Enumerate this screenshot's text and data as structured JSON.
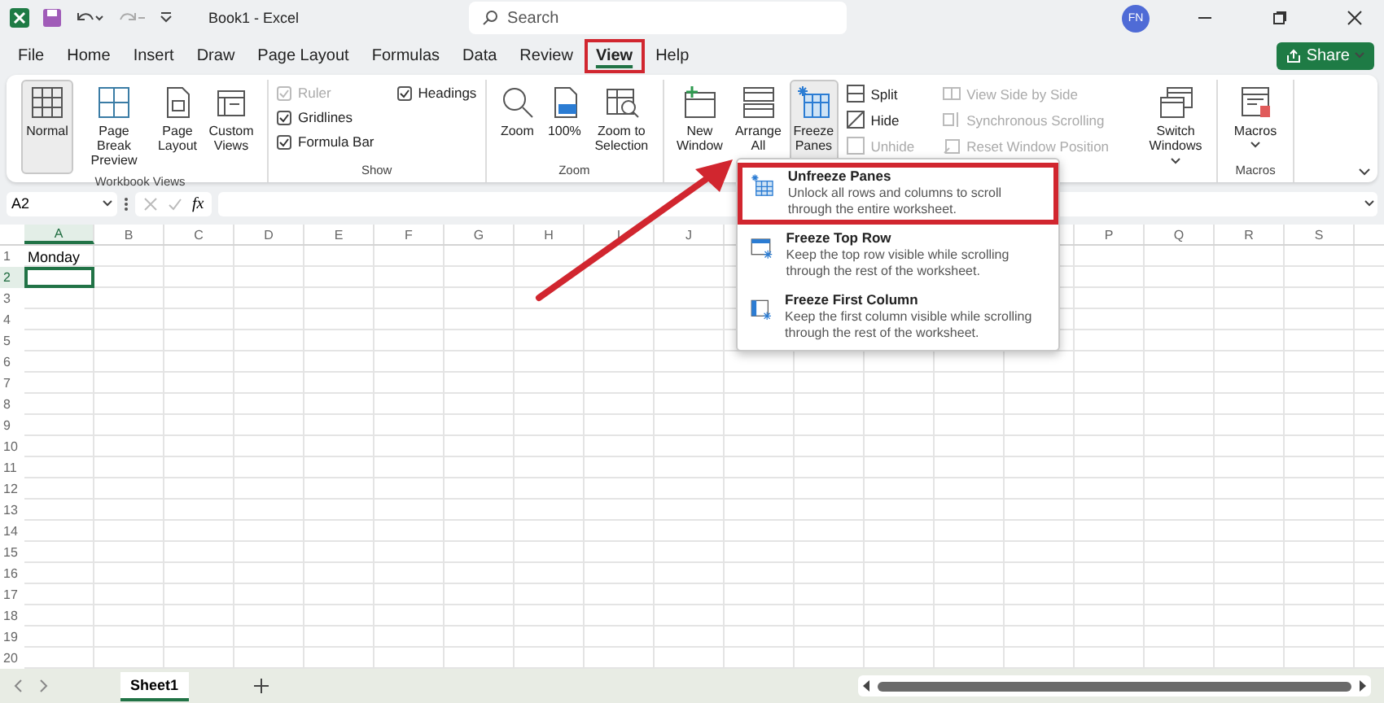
{
  "title_bar": {
    "title": "Book1  -  Excel",
    "search": {
      "placeholder": "Search"
    },
    "avatar": "FN"
  },
  "tabs": [
    {
      "label": "File",
      "selected": false,
      "highlighted": false
    },
    {
      "label": "Home",
      "selected": false,
      "highlighted": false
    },
    {
      "label": "Insert",
      "selected": false,
      "highlighted": false
    },
    {
      "label": "Draw",
      "selected": false,
      "highlighted": false
    },
    {
      "label": "Page Layout",
      "selected": false,
      "highlighted": false
    },
    {
      "label": "Formulas",
      "selected": false,
      "highlighted": false
    },
    {
      "label": "Data",
      "selected": false,
      "highlighted": false
    },
    {
      "label": "Review",
      "selected": false,
      "highlighted": false
    },
    {
      "label": "View",
      "selected": true,
      "highlighted": true
    },
    {
      "label": "Help",
      "selected": false,
      "highlighted": false
    }
  ],
  "share": "Share",
  "ribbon": {
    "workbook_views": {
      "label": "Workbook Views",
      "items": [
        {
          "label": "Normal",
          "selected": true
        },
        {
          "label": "Page Break Preview",
          "selected": false
        },
        {
          "label": "Page Layout",
          "selected": false
        },
        {
          "label": "Custom Views",
          "selected": false
        }
      ]
    },
    "show": {
      "label": "Show",
      "items": [
        {
          "label": "Ruler",
          "checked": true,
          "disabled": true
        },
        {
          "label": "Gridlines",
          "checked": true,
          "disabled": false
        },
        {
          "label": "Formula Bar",
          "checked": true,
          "disabled": false
        },
        {
          "label": "Headings",
          "checked": true,
          "disabled": false
        }
      ]
    },
    "zoom": {
      "label": "Zoom",
      "items": [
        {
          "label": "Zoom"
        },
        {
          "label": "100%"
        },
        {
          "label": "Zoom to Selection"
        }
      ]
    },
    "window": {
      "large": [
        {
          "label": "New Window",
          "selected": false
        },
        {
          "label": "Arrange All",
          "selected": false
        },
        {
          "label": "Freeze Panes",
          "selected": true
        }
      ],
      "small": [
        {
          "label": "Split",
          "disabled": false
        },
        {
          "label": "Hide",
          "disabled": false
        },
        {
          "label": "Unhide",
          "disabled": true
        },
        {
          "label": "View Side by Side",
          "disabled": true
        },
        {
          "label": "Synchronous Scrolling",
          "disabled": true
        },
        {
          "label": "Reset Window Position",
          "disabled": true
        }
      ],
      "switch": {
        "label": "Switch Windows"
      }
    },
    "macros": {
      "label": "Macros",
      "button": "Macros"
    }
  },
  "formula_bar": {
    "name_box": "A2",
    "fx": "fx"
  },
  "columns_left": [
    {
      "label": "A",
      "selected": true
    },
    {
      "label": "B",
      "selected": false
    },
    {
      "label": "C",
      "selected": false
    },
    {
      "label": "D",
      "selected": false
    },
    {
      "label": "E",
      "selected": false
    },
    {
      "label": "F",
      "selected": false
    },
    {
      "label": "G",
      "selected": false
    },
    {
      "label": "H",
      "selected": false
    },
    {
      "label": "I",
      "selected": false
    },
    {
      "label": "J",
      "selected": false
    }
  ],
  "columns_right": [
    {
      "label": "P",
      "selected": false
    },
    {
      "label": "Q",
      "selected": false
    },
    {
      "label": "R",
      "selected": false
    },
    {
      "label": "S",
      "selected": false
    }
  ],
  "rows": [
    {
      "header": "1",
      "selected": false,
      "cells": [
        "Monday"
      ]
    },
    {
      "header": "2",
      "selected": true
    },
    {
      "header": "3",
      "selected": false
    },
    {
      "header": "4",
      "selected": false
    },
    {
      "header": "5",
      "selected": false
    },
    {
      "header": "6",
      "selected": false
    },
    {
      "header": "7",
      "selected": false
    },
    {
      "header": "8",
      "selected": false
    },
    {
      "header": "9",
      "selected": false
    },
    {
      "header": "10",
      "selected": false
    },
    {
      "header": "11",
      "selected": false
    },
    {
      "header": "12",
      "selected": false
    },
    {
      "header": "13",
      "selected": false
    },
    {
      "header": "14",
      "selected": false
    },
    {
      "header": "15",
      "selected": false
    },
    {
      "header": "16",
      "selected": false
    },
    {
      "header": "17",
      "selected": false
    },
    {
      "header": "18",
      "selected": false
    },
    {
      "header": "19",
      "selected": false
    },
    {
      "header": "20",
      "selected": false
    }
  ],
  "freeze_menu": [
    {
      "kind": "unfreeze",
      "title": "Unfreeze Panes",
      "description": "Unlock all rows and columns to scroll through the entire worksheet.",
      "highlighted": true
    },
    {
      "kind": "top_row",
      "title": "Freeze Top Row",
      "description": "Keep the top row visible while scrolling through the rest of the worksheet.",
      "highlighted": false
    },
    {
      "kind": "first_column",
      "title": "Freeze First Column",
      "description": "Keep the first column visible while scrolling through the rest of the worksheet.",
      "highlighted": false
    }
  ],
  "sheets": [
    {
      "label": "Sheet1",
      "selected": true
    }
  ]
}
